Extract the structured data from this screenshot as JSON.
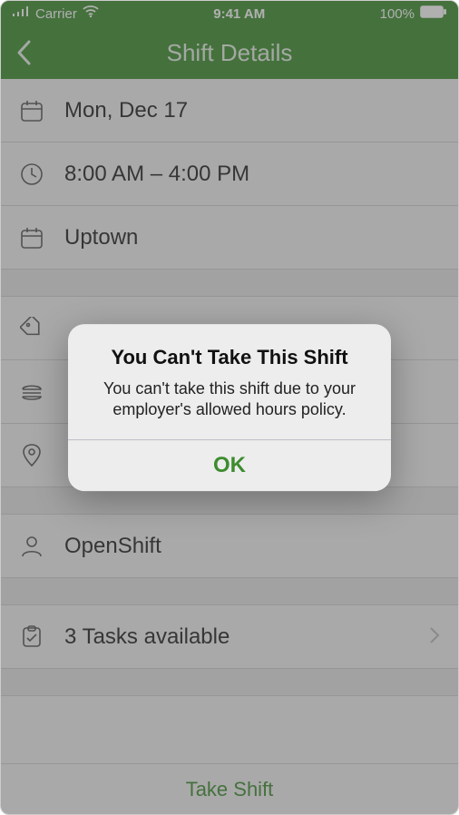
{
  "status": {
    "carrier": "Carrier",
    "time": "9:41 AM",
    "battery": "100%"
  },
  "nav": {
    "title": "Shift Details"
  },
  "rows": {
    "date": "Mon, Dec 17",
    "time": "8:00 AM – 4:00 PM",
    "location": "Uptown",
    "tag": "",
    "meal": "",
    "pin": "",
    "assignee": "OpenShift",
    "tasks": "3 Tasks available"
  },
  "footer": {
    "take_shift": "Take Shift"
  },
  "alert": {
    "title": "You Can't Take This Shift",
    "message": "You can't take this shift due to your employer's allowed hours policy.",
    "ok": "OK"
  }
}
